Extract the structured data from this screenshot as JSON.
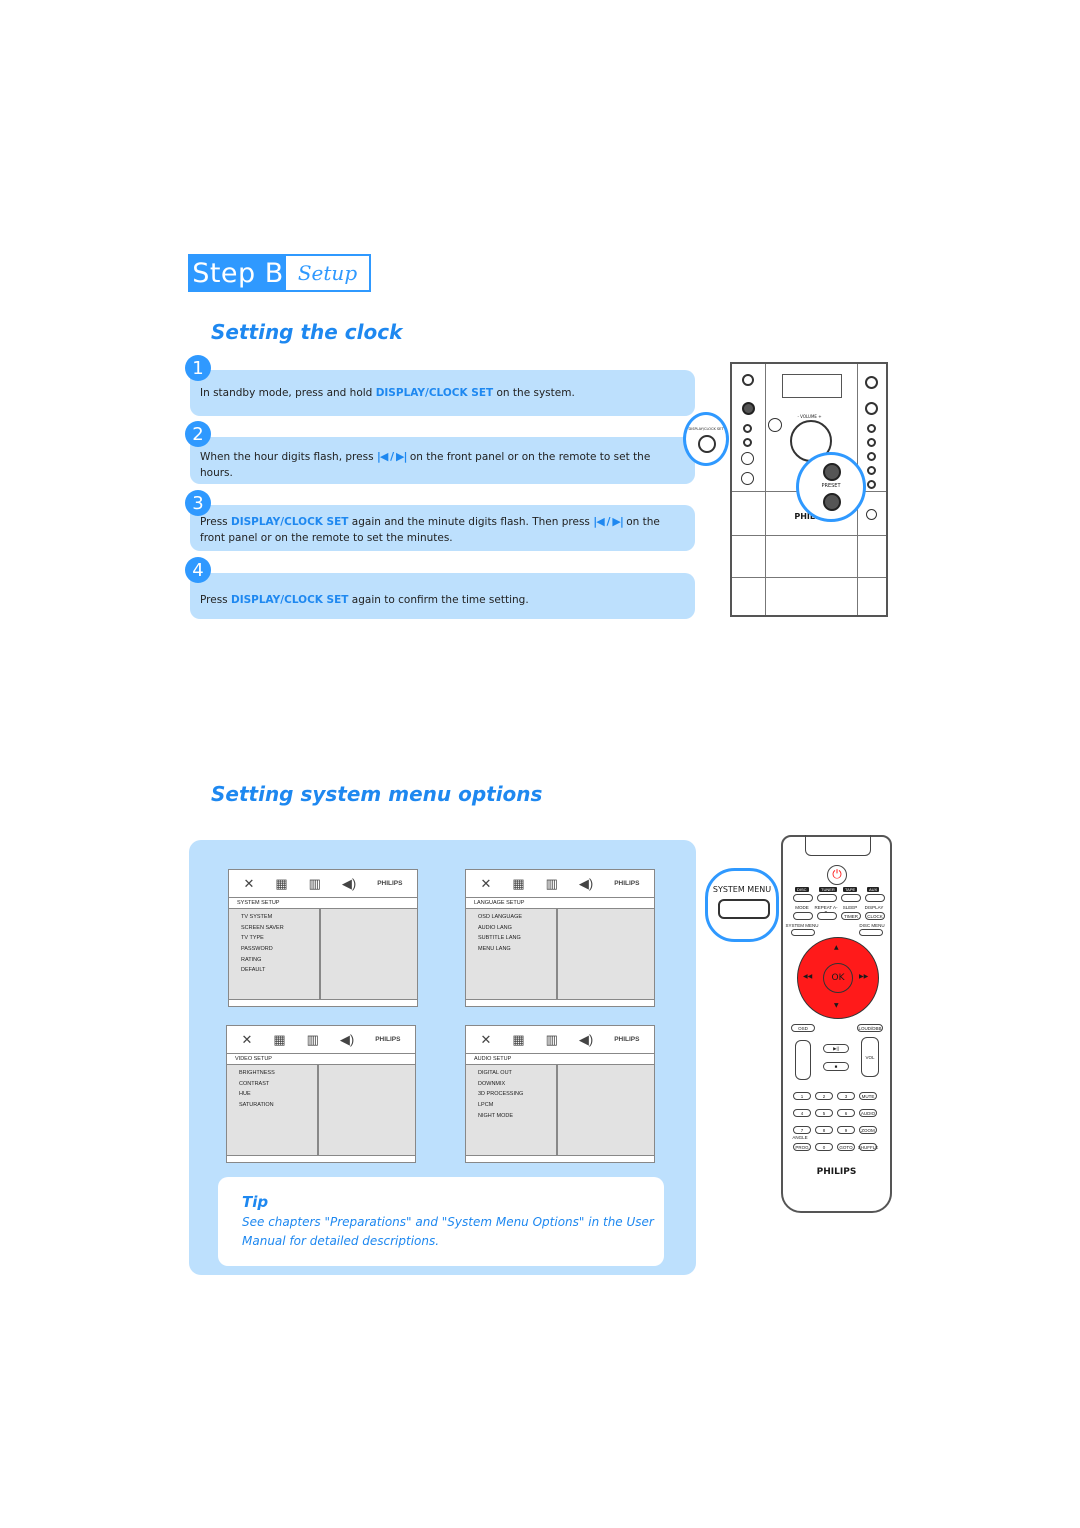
{
  "header": {
    "step": "Step B",
    "step_title": "Setup"
  },
  "clock_section": {
    "title": "Setting the clock",
    "steps": [
      {
        "number": "1",
        "parts": [
          {
            "t": "In standby mode, press and hold "
          },
          {
            "t": "DISPLAY/CLOCK SET",
            "hl": true
          },
          {
            "t": " on the system."
          }
        ]
      },
      {
        "number": "2",
        "before": "When the hour digits flash, press ",
        "arrows": "|◀ / ▶|",
        "after": " on the front panel or on the remote to set the hours."
      },
      {
        "number": "3",
        "before_plain": "Press ",
        "hl": "DISPLAY/CLOCK SET",
        "middle": " again and the minute digits flash. Then press ",
        "arrows": "|◀ / ▶|",
        "after": " on the front panel or on the remote to set the minutes."
      },
      {
        "number": "4",
        "before_plain": "Press ",
        "hl": "DISPLAY/CLOCK SET",
        "after": " again to confirm the time setting."
      }
    ],
    "step1_before": "In standby mode, press and hold ",
    "step1_hl": "DISPLAY/CLOCK SET",
    "step1_after": " on the system."
  },
  "device": {
    "callout_button_label": "DISPLAY/CLOCK SET",
    "callout_preset_label": "PRESET",
    "brand": "PHILIPS",
    "volume_label": "- VOLUME +"
  },
  "menu_section": {
    "title": "Setting system menu options",
    "screens": [
      {
        "title": "SYSTEM SETUP",
        "items": [
          "TV SYSTEM",
          "SCREEN SAVER",
          "TV TYPE",
          "PASSWORD",
          "RATING",
          "DEFAULT"
        ]
      },
      {
        "title": "LANGUAGE SETUP",
        "items": [
          "OSD LANGUAGE",
          "AUDIO LANG",
          "SUBTITLE LANG",
          "MENU LANG"
        ]
      },
      {
        "title": "VIDEO SETUP",
        "items": [
          "BRIGHTNESS",
          "CONTRAST",
          "HUE",
          "SATURATION"
        ]
      },
      {
        "title": "AUDIO SETUP",
        "items": [
          "DIGITAL OUT",
          "DOWNMIX",
          "3D PROCESSING",
          "LPCM",
          "NIGHT MODE"
        ]
      }
    ],
    "osd_brand": "PHILIPS",
    "tip": {
      "title": "Tip",
      "text": "See chapters \"Preparations\" and \"System Menu Options\" in the User Manual for detailed descriptions."
    }
  },
  "remote": {
    "callout_label": "SYSTEM MENU",
    "sources": [
      "DISC",
      "TUNER",
      "TAPE",
      "AUX"
    ],
    "row2_labels": [
      "MODE",
      "REPEAT A-B",
      "SLEEP",
      "DISPLAY"
    ],
    "row2_buttons": [
      "",
      "",
      "TIMER",
      "CLOCK"
    ],
    "system_menu": "SYSTEM MENU",
    "disc_menu": "DISC MENU",
    "ok": "OK",
    "osd": "OSD",
    "loud": "LOUD/DBB",
    "vol": "VOL",
    "keypad": [
      "1",
      "2",
      "3",
      "MUTE",
      "4",
      "5",
      "6",
      "AUDIO",
      "7",
      "8",
      "9",
      "ZOOM",
      "PROG",
      "0",
      "GOTO",
      "SHUFFLE"
    ],
    "angle": "ANGLE",
    "brand": "PHILIPS",
    "accent_color": "#ff1a1a"
  },
  "colors": {
    "accent": "#2f99ff",
    "panel": "#bde0fd",
    "highlight_text": "#1e88f0"
  }
}
